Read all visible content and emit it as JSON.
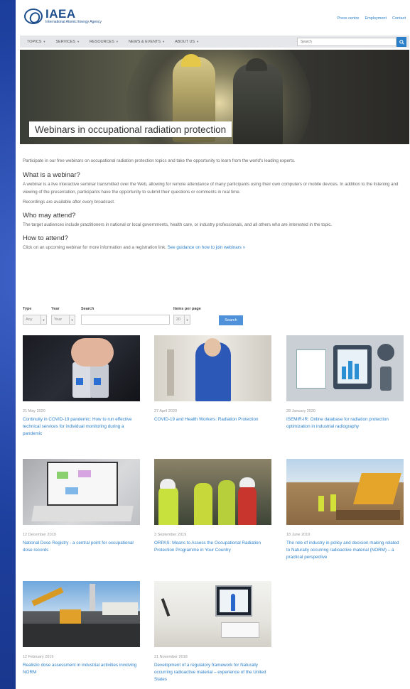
{
  "header": {
    "logo_name": "IAEA",
    "logo_sub": "International Atomic Energy Agency",
    "utility_links": [
      "Press centre",
      "Employment",
      "Contact"
    ]
  },
  "nav": {
    "items": [
      "TOPICS",
      "SERVICES",
      "RESOURCES",
      "NEWS & EVENTS",
      "ABOUT US"
    ],
    "search_placeholder": "Search",
    "search_icon": "search-icon"
  },
  "hero": {
    "title": "Webinars in occupational radiation protection"
  },
  "content": {
    "intro": "Participate in our free webinars on occupational radiation protection topics and take the opportunity to learn from the world's leading experts.",
    "sections": [
      {
        "heading": "What is a webinar?",
        "paragraphs": [
          "A webinar is a live interactive seminar transmitted over the Web, allowing for remote attendance of many participants using their own computers or mobile devices. In addition to the listening and viewing of the presentation, participants have the opportunity to submit their questions or comments in real time.",
          "Recordings are available after every broadcast."
        ]
      },
      {
        "heading": "Who may attend?",
        "paragraphs": [
          "The target audiences include practitioners in national or local governments, health care, or industry professionals, and all others who are interested in the topic."
        ]
      },
      {
        "heading": "How to attend?",
        "paragraphs": [
          "Click on an upcoming webinar for more information and a registration link."
        ],
        "link": "See guidance on how to join webinars »"
      }
    ]
  },
  "filters": {
    "type_label": "Type",
    "type_value": "Any",
    "year_label": "Year",
    "year_value": "Year",
    "search_label": "Search",
    "items_label": "Items per page",
    "items_value": "20",
    "button": "Search"
  },
  "cards": [
    {
      "date": "21 May 2020",
      "title": "Continuity in COVID-19 pandemic: How to run effective technical services for individual monitoring during a pandemic"
    },
    {
      "date": "27 April 2020",
      "title": "COVID-19 and Health Workers: Radiation Protection"
    },
    {
      "date": "28 January 2020",
      "title": "ISEMIR-IR: Online database for radiation protection optimization in industrial radiography"
    },
    {
      "date": "12 December 2019",
      "title": "National Dose Registry - a central point for occupational dose records"
    },
    {
      "date": "3 September 2019",
      "title": "ORPAS: Means to Assess the Occupational Radiation Protection Programme in Your Country"
    },
    {
      "date": "18 June 2019",
      "title": "The role of industry in policy and decision making related to Naturally occurring radioactive material (NORM) – a practical perspective"
    },
    {
      "date": "12 February 2019",
      "title": "Realistic dose assessment in industrial activities involving NORM"
    },
    {
      "date": "21 November 2018",
      "title": "Development of a regulatory framework for Naturally occurring radioactive material – experience of the United States"
    }
  ]
}
